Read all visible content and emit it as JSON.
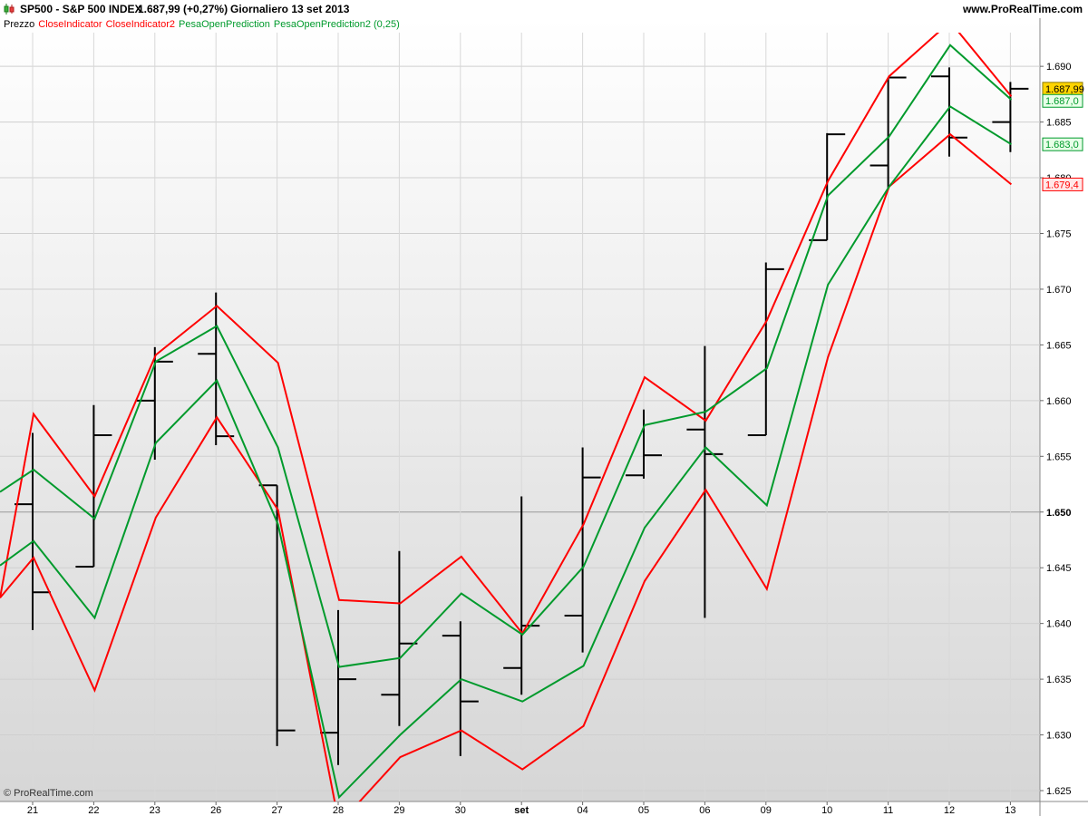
{
  "header": {
    "symbol_label": "SP500 - S&P 500 INDEX",
    "price_change": "1.687,99 (+0,27%)",
    "period_date": "Giornaliero  13 set 2013",
    "site": "www.ProRealTime.com"
  },
  "legend": {
    "prezzo": "Prezzo",
    "close_indicator": "CloseIndicator",
    "close_indicator2": "CloseIndicator2",
    "pesa_open_prediction": "PesaOpenPrediction",
    "pesa_open_prediction2": "PesaOpenPrediction2 (0,25)"
  },
  "copyright": "© ProRealTime.com",
  "colors": {
    "red": "#ff0000",
    "green": "#009a2c",
    "bars": "#000000",
    "last_price_bg": "#ffd400"
  },
  "chart_data": {
    "type": "line",
    "x": [
      "21",
      "22",
      "23",
      "26",
      "27",
      "28",
      "29",
      "30",
      "set",
      "04",
      "05",
      "06",
      "09",
      "10",
      "11",
      "12",
      "13"
    ],
    "ylim": [
      1624,
      1694
    ],
    "y_ticks": [
      "1.625",
      "1.630",
      "1.635",
      "1.640",
      "1.645",
      "1.650",
      "1.655",
      "1.660",
      "1.665",
      "1.670",
      "1.675",
      "1.680",
      "1.685",
      "1.690"
    ],
    "ohlc": [
      {
        "open": 1650.7,
        "high": 1657.1,
        "low": 1639.4,
        "close": 1642.8
      },
      {
        "open": 1645.1,
        "high": 1659.6,
        "low": 1645.1,
        "close": 1656.9
      },
      {
        "open": 1660.0,
        "high": 1664.8,
        "low": 1654.7,
        "close": 1663.5
      },
      {
        "open": 1664.2,
        "high": 1669.7,
        "low": 1656.0,
        "close": 1656.8
      },
      {
        "open": 1652.4,
        "high": 1652.4,
        "low": 1629.0,
        "close": 1630.4
      },
      {
        "open": 1630.2,
        "high": 1641.2,
        "low": 1627.3,
        "close": 1635.0
      },
      {
        "open": 1633.6,
        "high": 1646.5,
        "low": 1630.8,
        "close": 1638.2
      },
      {
        "open": 1638.9,
        "high": 1640.2,
        "low": 1628.1,
        "close": 1633.0
      },
      {
        "open": 1636.0,
        "high": 1651.4,
        "low": 1633.6,
        "close": 1639.8
      },
      {
        "open": 1640.7,
        "high": 1655.8,
        "low": 1637.4,
        "close": 1653.1
      },
      {
        "open": 1653.3,
        "high": 1659.2,
        "low": 1653.0,
        "close": 1655.1
      },
      {
        "open": 1657.4,
        "high": 1664.9,
        "low": 1640.5,
        "close": 1655.2
      },
      {
        "open": 1656.9,
        "high": 1672.4,
        "low": 1656.9,
        "close": 1671.8
      },
      {
        "open": 1674.4,
        "high": 1684.0,
        "low": 1674.4,
        "close": 1683.9
      },
      {
        "open": 1681.1,
        "high": 1689.0,
        "low": 1679.0,
        "close": 1689.0
      },
      {
        "open": 1689.1,
        "high": 1689.9,
        "low": 1681.9,
        "close": 1683.6
      },
      {
        "open": 1685.0,
        "high": 1688.6,
        "low": 1682.3,
        "close": 1687.99
      }
    ],
    "series": [
      {
        "name": "CloseIndicator",
        "color": "#ff0000",
        "values": [
          1642.3,
          1658.8,
          1651.4,
          1664.1,
          1668.5,
          1663.4,
          1642.1,
          1641.8,
          1646.0,
          1639.1,
          1648.9,
          1662.1,
          1658.2,
          1667.2,
          1679.7,
          1689.1,
          1694.0,
          1687.3
        ]
      },
      {
        "name": "CloseIndicator2",
        "color": "#ff0000",
        "values": [
          1642.3,
          1645.9,
          1634.0,
          1649.5,
          1658.5,
          1650.2,
          1622.0,
          1628.0,
          1630.4,
          1626.9,
          1630.8,
          1643.8,
          1652.0,
          1643.1,
          1663.9,
          1679.2,
          1683.9,
          1679.4
        ]
      },
      {
        "name": "PesaOpenPrediction",
        "color": "#009a2c",
        "values": [
          1651.8,
          1653.8,
          1649.4,
          1663.5,
          1666.7,
          1655.8,
          1636.1,
          1636.9,
          1642.7,
          1639.0,
          1645.1,
          1657.8,
          1659.0,
          1662.9,
          1678.4,
          1683.7,
          1691.9,
          1687.0
        ]
      },
      {
        "name": "PesaOpenPrediction2 (0,25)",
        "color": "#009a2c",
        "values": [
          1645.2,
          1647.4,
          1640.5,
          1656.2,
          1661.8,
          1648.9,
          1624.4,
          1630.0,
          1635.0,
          1633.0,
          1636.2,
          1648.6,
          1655.8,
          1650.6,
          1670.4,
          1679.2,
          1686.4,
          1683.0
        ]
      }
    ],
    "price_labels": [
      {
        "text": "1.687,99",
        "value": 1687.99,
        "bg": "#ffd400",
        "fg": "#000000"
      },
      {
        "text": "1.687,0",
        "value": 1686.9,
        "bg": "#e8ffe8",
        "fg": "#009a2c"
      },
      {
        "text": "1.683,0",
        "value": 1683.0,
        "bg": "#e8ffe8",
        "fg": "#009a2c"
      },
      {
        "text": "1.679,4",
        "value": 1679.4,
        "bg": "#ffe8e8",
        "fg": "#ff0000"
      }
    ],
    "grid": true,
    "reference_line": 1650
  }
}
